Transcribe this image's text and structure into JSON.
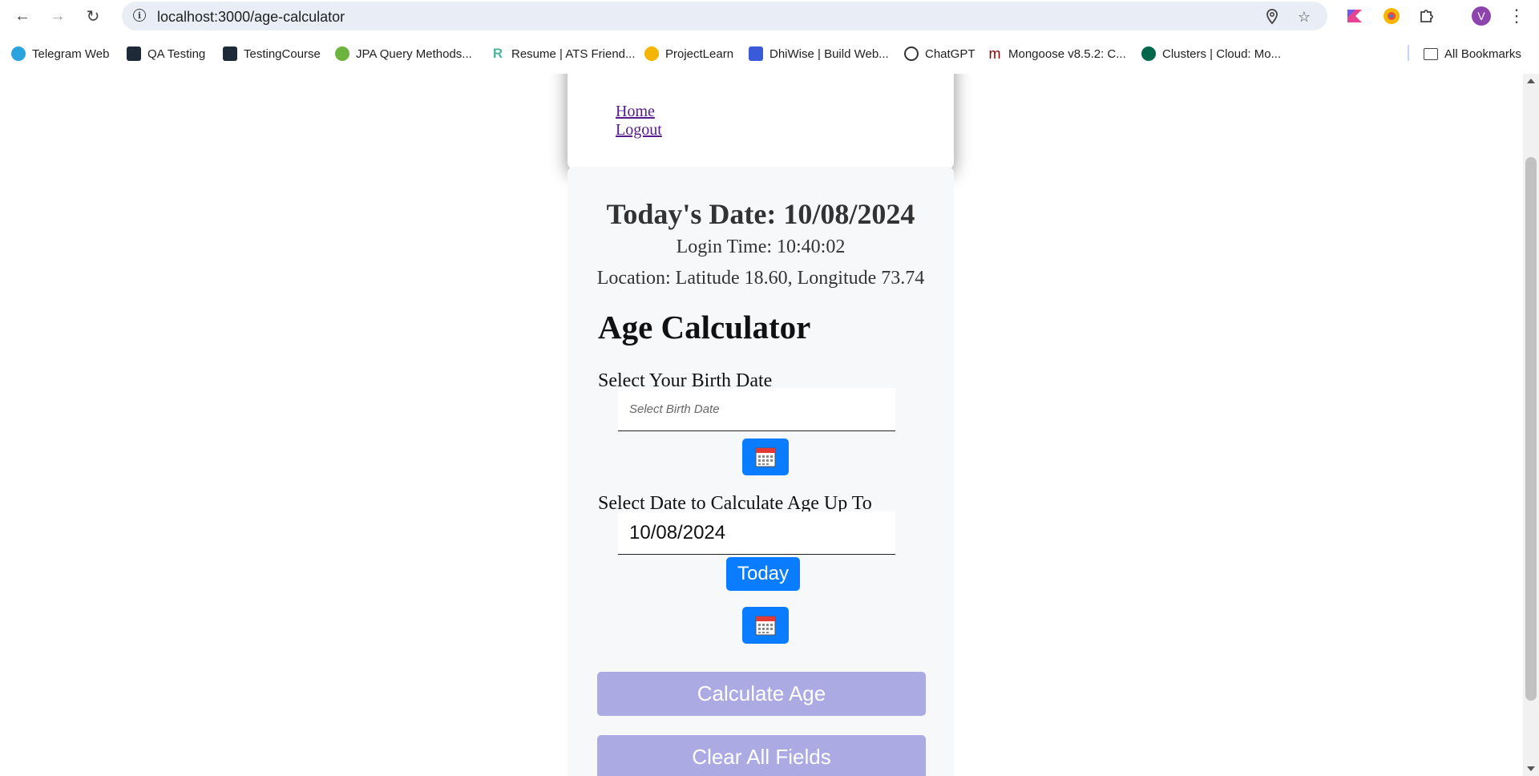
{
  "browser": {
    "url": "localhost:3000/age-calculator",
    "avatar_letter": "V",
    "bookmarks": [
      {
        "label": "Telegram Web",
        "color": "#2aa3df"
      },
      {
        "label": "QA Testing",
        "color": "#1e2a38"
      },
      {
        "label": "TestingCourse",
        "color": "#1e2a38"
      },
      {
        "label": "JPA Query Methods...",
        "color": "#6db33f"
      },
      {
        "label": "Resume | ATS Friend...",
        "color": "#4fb59a"
      },
      {
        "label": "ProjectLearn",
        "color": "#f4b400"
      },
      {
        "label": "DhiWise | Build Web...",
        "color": "#3a5bd9"
      },
      {
        "label": "ChatGPT",
        "color": "#333333"
      },
      {
        "label": "Mongoose v8.5.2: C...",
        "color": "#880000"
      },
      {
        "label": "Clusters | Cloud: Mo...",
        "color": "#00684a"
      }
    ],
    "all_bookmarks_label": "All Bookmarks"
  },
  "nav": {
    "home_label": "Home",
    "logout_label": "Logout"
  },
  "info": {
    "todays_date": "Today's Date: 10/08/2024",
    "login_time": "Login Time: 10:40:02",
    "location": "Location: Latitude 18.60, Longitude 73.74"
  },
  "calculator": {
    "heading": "Age Calculator",
    "birth_label": "Select Your Birth Date",
    "birth_placeholder": "Select Birth Date",
    "birth_value": "",
    "upto_label": "Select Date to Calculate Age Up To",
    "upto_value": "10/08/2024",
    "today_button": "Today",
    "calculate_button": "Calculate Age",
    "clear_button": "Clear All Fields"
  },
  "colors": {
    "primary_blue": "#0a7cff",
    "disabled_purple": "#abaae3",
    "link_visited": "#551a8b"
  }
}
